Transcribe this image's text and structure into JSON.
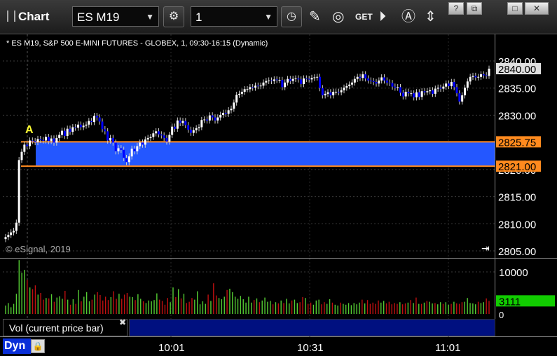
{
  "window": {
    "title": "Chart",
    "symbol": "ES M19",
    "interval": "1",
    "buttons": {
      "minimize": "?",
      "restore": "⧉",
      "maximize": "□",
      "close": "✕"
    }
  },
  "toolbar_icons": [
    "gear-icon",
    "clock-icon",
    "pencil-icon",
    "study-icon",
    "get-icon",
    "play-icon",
    "annotate-icon",
    "cursor-icon"
  ],
  "chart_title": "* ES M19, S&P 500 E-MINI FUTURES - GLOBEX, 1, 09:30-16:15 (Dynamic)",
  "copyright": "© eSignal, 2019",
  "annotation_label": "A",
  "vol_label": "Vol (current price bar)",
  "dyn_label": "Dyn",
  "colors": {
    "up": "#ffffff",
    "down": "#0000ff",
    "zone": "#2457ff",
    "zone_border": "#ff8a1e",
    "vol_up": "#55cc33",
    "vol_down": "#c01010",
    "vol_badge": "#11cc00",
    "price_badge": "#e0e0e0"
  },
  "chart_data": [
    {
      "type": "candlestick",
      "title": "* ES M19, S&P 500 E-MINI FUTURES - GLOBEX, 1, 09:30-16:15 (Dynamic)",
      "ylim": [
        2804.5,
        2841.5
      ],
      "y_ticks": [
        "2840.00",
        "2835.00",
        "2830.00",
        "2825.00",
        "2820.00",
        "2815.00",
        "2810.00",
        "2805.00"
      ],
      "x_ticks": [
        "10:01",
        "10:31",
        "11:01"
      ],
      "last_price": "2840.00",
      "zone": {
        "top": 2825.75,
        "bottom": 2821.0,
        "top_label": "2825.75",
        "bottom_label": "2821.00"
      },
      "close": [
        2807.2,
        2807.6,
        2808.1,
        2808.4,
        2810.0,
        2822.2,
        2823.8,
        2825.2,
        2824.9,
        2826.0,
        2825.9,
        2825.7,
        2826.3,
        2826.1,
        2826.0,
        2826.7,
        2825.9,
        2826.4,
        2825.6,
        2826.5,
        2827.1,
        2827.9,
        2826.9,
        2828.3,
        2827.7,
        2828.6,
        2828.5,
        2829.1,
        2828.6,
        2828.9,
        2829.1,
        2829.8,
        2829.6,
        2830.8,
        2830.5,
        2829.7,
        2828.2,
        2827.8,
        2826.0,
        2826.5,
        2825.6,
        2823.9,
        2824.5,
        2824.2,
        2822.6,
        2821.8,
        2822.9,
        2824.4,
        2823.9,
        2824.9,
        2825.6,
        2825.2,
        2826.2,
        2826.5,
        2826.7,
        2827.4,
        2827.8,
        2827.2,
        2827.0,
        2826.5,
        2825.8,
        2827.1,
        2828.7,
        2828.3,
        2829.9,
        2829.4,
        2829.8,
        2829.0,
        2828.1,
        2827.5,
        2828.0,
        2828.4,
        2828.6,
        2830.0,
        2830.1,
        2829.9,
        2830.9,
        2830.5,
        2829.9,
        2830.5,
        2831.0,
        2831.4,
        2831.2,
        2831.9,
        2832.2,
        2833.4,
        2834.9,
        2835.1,
        2835.5,
        2836.0,
        2836.0,
        2836.4,
        2836.3,
        2836.7,
        2836.6,
        2836.7,
        2837.3,
        2837.6,
        2837.7,
        2837.6,
        2837.9,
        2837.8,
        2837.8,
        2836.4,
        2837.3,
        2838.0,
        2837.6,
        2838.0,
        2838.1,
        2837.9,
        2837.0,
        2838.1,
        2838.0,
        2837.9,
        2838.2,
        2838.3,
        2838.4,
        2836.2,
        2834.8,
        2835.1,
        2835.4,
        2834.8,
        2835.5,
        2835.5,
        2835.4,
        2835.8,
        2836.3,
        2836.6,
        2836.9,
        2837.3,
        2838.0,
        2838.4,
        2838.2,
        2838.9,
        2838.1,
        2837.7,
        2837.6,
        2837.4,
        2837.1,
        2837.7,
        2838.3,
        2837.7,
        2837.3,
        2837.2,
        2836.5,
        2836.3,
        2836.4,
        2835.3,
        2834.6,
        2835.5,
        2835.2,
        2835.2,
        2834.4,
        2835.4,
        2834.5,
        2835.6,
        2835.4,
        2835.6,
        2835.8,
        2835.1,
        2836.1,
        2836.3,
        2836.1,
        2836.5,
        2837.1,
        2836.6,
        2837.4,
        2836.4,
        2835.2,
        2833.6,
        2834.8,
        2836.3,
        2837.5,
        2838.4,
        2838.6,
        2838.3,
        2838.4,
        2838.9,
        2838.7,
        2838.6,
        2840.0
      ],
      "high_offset": 0.6,
      "low_offset": 0.6
    },
    {
      "type": "bar",
      "title": "Vol (current price bar)",
      "ylim": [
        0,
        12000
      ],
      "y_ticks": [
        "10000"
      ],
      "last_volume": "3111",
      "zero_label": "0",
      "values": [
        2000,
        2600,
        1600,
        2400,
        4800,
        12800,
        9800,
        10500,
        8100,
        6300,
        5900,
        6800,
        4600,
        5000,
        3400,
        3800,
        3700,
        4700,
        2900,
        3900,
        4200,
        3600,
        5500,
        3400,
        2200,
        3500,
        2400,
        5700,
        3000,
        4100,
        5200,
        3000,
        3400,
        4600,
        5200,
        4500,
        3200,
        4100,
        3300,
        4000,
        5400,
        3600,
        4800,
        3600,
        4600,
        5000,
        4100,
        4000,
        3300,
        4700,
        3600,
        3000,
        2600,
        3200,
        3000,
        3300,
        4900,
        3400,
        3100,
        2200,
        3800,
        2800,
        6300,
        4000,
        5900,
        3700,
        4800,
        2600,
        2900,
        3800,
        3400,
        5400,
        2300,
        3000,
        2400,
        4600,
        3100,
        7300,
        4400,
        3800,
        3500,
        4100,
        5700,
        6000,
        5200,
        4100,
        3600,
        4300,
        3500,
        2700,
        4100,
        2700,
        3300,
        3700,
        2800,
        3200,
        3900,
        2900,
        3100,
        2300,
        2800,
        2500,
        3200,
        2600,
        3600,
        2500,
        3200,
        3400,
        2600,
        2800,
        4000,
        3800,
        2400,
        2700,
        2200,
        3200,
        3400,
        2300,
        2800,
        2400,
        3500,
        2700,
        2200,
        2000,
        2700,
        2400,
        2200,
        2600,
        2100,
        2600,
        2300,
        2700,
        3400,
        2500,
        3300,
        2400,
        2700,
        2400,
        3200,
        2700,
        3100,
        2500,
        2900,
        2300,
        2600,
        2400,
        2800,
        2300,
        2500,
        2700,
        3300,
        2600,
        3900,
        2400,
        2400,
        2700,
        3100,
        2900,
        2500,
        2600,
        2300,
        2800,
        2400,
        2800,
        2200,
        2400,
        2900,
        2500,
        2400,
        2800,
        2900,
        3800,
        2600,
        2500,
        2300,
        2900,
        2600,
        2800,
        3700,
        3111
      ]
    }
  ]
}
